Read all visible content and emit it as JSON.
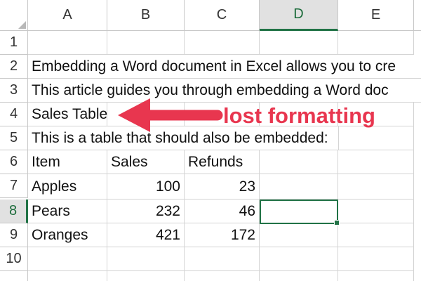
{
  "columns": [
    "A",
    "B",
    "C",
    "D",
    "E"
  ],
  "selected_column": "D",
  "rows": [
    "1",
    "2",
    "3",
    "4",
    "5",
    "6",
    "7",
    "8",
    "9",
    "10"
  ],
  "selected_row": "8",
  "cells": {
    "A2": "Embedding a Word document in Excel allows you to cre",
    "A3": "This article guides you through embedding a Word doc",
    "A4": "Sales Table",
    "A5": "This is a table that should also be embedded:",
    "A6": "Item",
    "B6": "Sales",
    "C6": "Refunds",
    "A7": "Apples",
    "B7": "100",
    "C7": "23",
    "A8": "Pears",
    "B8": "232",
    "C8": "46",
    "A9": "Oranges",
    "B9": "421",
    "C9": "172"
  },
  "active_cell": "D8",
  "annotation": {
    "text": "lost formatting",
    "color": "#e8364f"
  },
  "accent_color": "#217346"
}
